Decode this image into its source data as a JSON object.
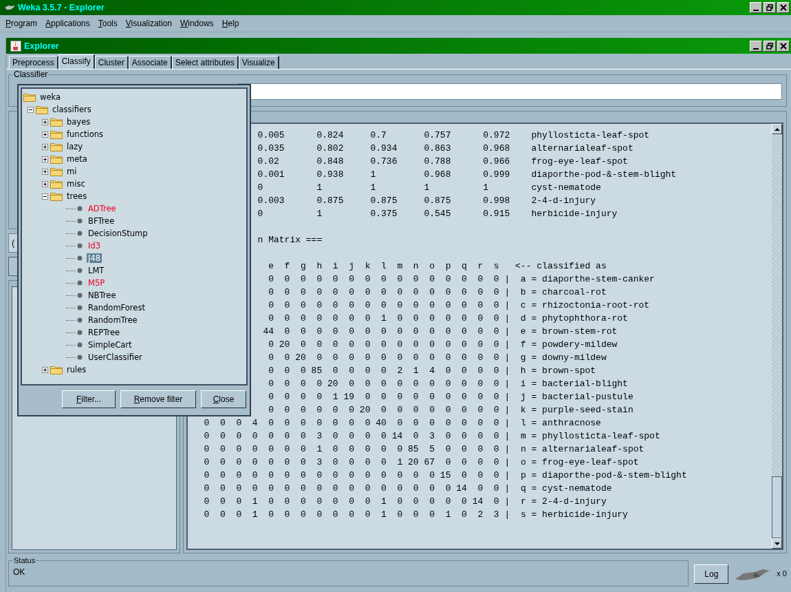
{
  "window": {
    "title": "Weka 3.5.7 - Explorer"
  },
  "menu": [
    "Program",
    "Applications",
    "Tools",
    "Visualization",
    "Windows",
    "Help"
  ],
  "explorer": {
    "title": "Explorer"
  },
  "tabs": [
    {
      "label": "Preprocess",
      "selected": false
    },
    {
      "label": "Classify",
      "selected": true
    },
    {
      "label": "Cluster",
      "selected": false
    },
    {
      "label": "Associate",
      "selected": false
    },
    {
      "label": "Select attributes",
      "selected": false
    },
    {
      "label": "Visualize",
      "selected": false
    }
  ],
  "classifier": {
    "label": "Classifier"
  },
  "test_options": {
    "combo_text": "("
  },
  "output": {
    "lines": [
      {
        "text": "0.005      0.824     0.7       0.757      0.972    phyllosticta-leaf-spot",
        "covered": true,
        "space_before": false
      },
      {
        "text": "0.035      0.802     0.934     0.863      0.968    alternarialeaf-spot",
        "covered": true,
        "space_before": false
      },
      {
        "text": "0.02       0.848     0.736     0.788      0.966    frog-eye-leaf-spot",
        "covered": true,
        "space_before": false
      },
      {
        "text": "0.001      0.938     1         0.968      0.999    diaporthe-pod-&-stem-blight",
        "covered": true,
        "space_before": false
      },
      {
        "text": "0          1         1         1          1        cyst-nematode",
        "covered": true,
        "space_before": false
      },
      {
        "text": "0.003      0.875     0.875     0.875      0.998    2-4-d-injury",
        "covered": true,
        "space_before": false
      },
      {
        "text": "0          1         0.375     0.545      0.915    herbicide-injury",
        "covered": true,
        "space_before": false
      },
      {
        "text": "n Matrix ===",
        "covered": true,
        "space_before": true
      },
      {
        "text": "  e  f  g  h  i  j  k  l  m  n  o  p  q  r  s   <-- classified as",
        "covered": true,
        "space_before": true
      },
      {
        "text": "  0  0  0  0  0  0  0  0  0  0  0  0  0  0  0 |  a = diaporthe-stem-canker",
        "covered": true,
        "space_before": false
      },
      {
        "text": "  0  0  0  0  0  0  0  0  0  0  0  0  0  0  0 |  b = charcoal-rot",
        "covered": true,
        "space_before": false
      },
      {
        "text": "  0  0  0  0  0  0  0  0  0  0  0  0  0  0  0 |  c = rhizoctonia-root-rot",
        "covered": true,
        "space_before": false
      },
      {
        "text": "  0  0  0  0  0  0  0  1  0  0  0  0  0  0  0 |  d = phytophthora-rot",
        "covered": true,
        "space_before": false
      },
      {
        "text": " 44  0  0  0  0  0  0  0  0  0  0  0  0  0  0 |  e = brown-stem-rot",
        "covered": true,
        "space_before": false
      },
      {
        "text": "  0 20  0  0  0  0  0  0  0  0  0  0  0  0  0 |  f = powdery-mildew",
        "covered": true,
        "space_before": false
      },
      {
        "text": "  0  0 20  0  0  0  0  0  0  0  0  0  0  0  0 |  g = downy-mildew",
        "covered": true,
        "space_before": false
      },
      {
        "text": "  0  0  0 85  0  0  0  0  2  1  4  0  0  0  0 |  h = brown-spot",
        "covered": true,
        "space_before": false
      },
      {
        "text": "  0  0  0  0 20  0  0  0  0  0  0  0  0  0  0 |  i = bacterial-blight",
        "covered": true,
        "space_before": false
      },
      {
        "text": "  0  0  0  0  1 19  0  0  0  0  0  0  0  0  0 |  j = bacterial-pustule",
        "covered": true,
        "space_before": false
      },
      {
        "text": "  0  0  0  0  0  0 20  0  0  0  0  0  0  0  0 |  k = purple-seed-stain",
        "covered": true,
        "space_before": false
      },
      {
        "text": "  0  0  0  4  0  0  0  0  0  0  0 40  0  0  0  0  0  0  0 |  l = anthracnose",
        "covered": false,
        "space_before": false
      },
      {
        "text": "  0  0  0  0  0  0  0  3  0  0  0  0 14  0  3  0  0  0  0 |  m = phyllosticta-leaf-spot",
        "covered": false,
        "space_before": false
      },
      {
        "text": "  0  0  0  0  0  0  0  1  0  0  0  0  0 85  5  0  0  0  0 |  n = alternarialeaf-spot",
        "covered": false,
        "space_before": false
      },
      {
        "text": "  0  0  0  0  0  0  0  3  0  0  0  0  1 20 67  0  0  0  0 |  o = frog-eye-leaf-spot",
        "covered": false,
        "space_before": false
      },
      {
        "text": "  0  0  0  0  0  0  0  0  0  0  0  0  0  0  0 15  0  0  0 |  p = diaporthe-pod-&-stem-blight",
        "covered": false,
        "space_before": false
      },
      {
        "text": "  0  0  0  0  0  0  0  0  0  0  0  0  0  0  0  0 14  0  0 |  q = cyst-nematode",
        "covered": false,
        "space_before": false
      },
      {
        "text": "  0  0  0  1  0  0  0  0  0  0  0  1  0  0  0  0  0 14  0 |  r = 2-4-d-injury",
        "covered": false,
        "space_before": false
      },
      {
        "text": "  0  0  0  1  0  0  0  0  0  0  0  1  0  0  0  1  0  2  3 |  s = herbicide-injury",
        "covered": false,
        "space_before": false
      }
    ]
  },
  "chooser": {
    "tree": {
      "label": "weka",
      "children": [
        {
          "label": "classifiers",
          "expanded": true,
          "children": [
            {
              "label": "bayes",
              "expanded": false
            },
            {
              "label": "functions",
              "expanded": false
            },
            {
              "label": "lazy",
              "expanded": false
            },
            {
              "label": "meta",
              "expanded": false
            },
            {
              "label": "mi",
              "expanded": false
            },
            {
              "label": "misc",
              "expanded": false
            },
            {
              "label": "trees",
              "expanded": true,
              "children": [
                {
                  "label": "ADTree",
                  "incompatible": true,
                  "selected": false
                },
                {
                  "label": "BFTree",
                  "incompatible": false,
                  "selected": false
                },
                {
                  "label": "DecisionStump",
                  "incompatible": false,
                  "selected": false
                },
                {
                  "label": "Id3",
                  "incompatible": true,
                  "selected": false
                },
                {
                  "label": "J48",
                  "incompatible": false,
                  "selected": true
                },
                {
                  "label": "LMT",
                  "incompatible": false,
                  "selected": false
                },
                {
                  "label": "M5P",
                  "incompatible": true,
                  "selected": false
                },
                {
                  "label": "NBTree",
                  "incompatible": false,
                  "selected": false
                },
                {
                  "label": "RandomForest",
                  "incompatible": false,
                  "selected": false
                },
                {
                  "label": "RandomTree",
                  "incompatible": false,
                  "selected": false
                },
                {
                  "label": "REPTree",
                  "incompatible": false,
                  "selected": false
                },
                {
                  "label": "SimpleCart",
                  "incompatible": false,
                  "selected": false
                },
                {
                  "label": "UserClassifier",
                  "incompatible": false,
                  "selected": false
                }
              ]
            },
            {
              "label": "rules",
              "expanded": false
            }
          ]
        }
      ]
    },
    "buttons": [
      "Filter...",
      "Remove filter",
      "Close"
    ]
  },
  "status": {
    "label": "Status",
    "text": "OK",
    "log_button": "Log",
    "count": "x 0"
  }
}
